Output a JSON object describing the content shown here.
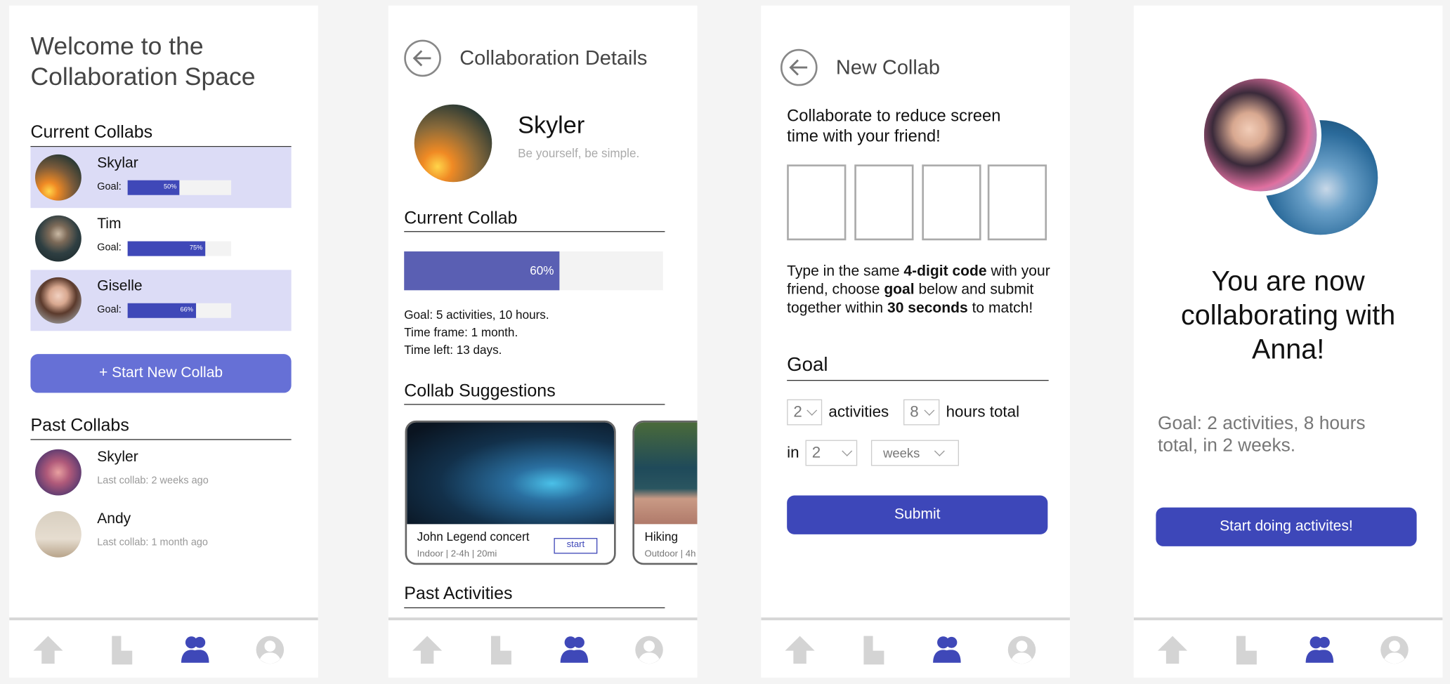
{
  "colors": {
    "accent": "#3f48b8",
    "accent_light": "#6670d6",
    "highlight": "#dcdcf6",
    "progress": "#5a5fb3"
  },
  "nav": {
    "items": [
      {
        "icon": "home-icon"
      },
      {
        "icon": "stats-icon"
      },
      {
        "icon": "collab-icon",
        "active": true
      },
      {
        "icon": "profile-icon"
      }
    ]
  },
  "screen1": {
    "title_line1": "Welcome to the",
    "title_line2": "Collaboration Space",
    "current_heading": "Current Collabs",
    "current": [
      {
        "name": "Skylar",
        "goal_label": "Goal:",
        "progress": 50,
        "progress_label": "50%"
      },
      {
        "name": "Tim",
        "goal_label": "Goal:",
        "progress": 75,
        "progress_label": "75%"
      },
      {
        "name": "Giselle",
        "goal_label": "Goal:",
        "progress": 66,
        "progress_label": "66%"
      }
    ],
    "start_button": "+ Start New Collab",
    "past_heading": "Past Collabs",
    "past": [
      {
        "name": "Skyler",
        "last": "Last collab: 2 weeks ago"
      },
      {
        "name": "Andy",
        "last": "Last collab: 1 month ago"
      }
    ]
  },
  "screen2": {
    "title": "Collaboration Details",
    "name": "Skyler",
    "bio": "Be yourself, be simple.",
    "current_heading": "Current Collab",
    "progress": 60,
    "progress_label": "60%",
    "goal": "Goal: 5 activities, 10 hours.",
    "timeframe": "Time frame: 1 month.",
    "timeleft": "Time left: 13 days.",
    "suggestions_heading": "Collab Suggestions",
    "suggestions": [
      {
        "title": "John Legend concert",
        "meta": "Indoor | 2-4h | 20mi",
        "action": "start"
      },
      {
        "title": "Hiking",
        "meta": "Outdoor | 4h"
      }
    ],
    "past_heading": "Past Activities"
  },
  "screen3": {
    "title": "New Collab",
    "intro_line1": "Collaborate to reduce screen",
    "intro_line2": "time with your friend!",
    "instr": {
      "p1": "Type in the same ",
      "b1": "4-digit code",
      "p2": " with your friend, choose ",
      "b2": "goal",
      "p3": " below and submit together within ",
      "b3": "30 seconds",
      "p4": " to match!"
    },
    "goal_heading": "Goal",
    "activities_value": "2",
    "activities_label": "activities",
    "hours_value": "8",
    "hours_label": "hours total",
    "in_label": "in",
    "period_value": "2",
    "unit_value": "weeks",
    "submit": "Submit"
  },
  "screen4": {
    "line1": "You are now",
    "line2": "collaborating with",
    "line3": "Anna!",
    "goal": "Goal: 2 activities, 8 hours total, in 2 weeks.",
    "button": "Start doing activites!"
  }
}
